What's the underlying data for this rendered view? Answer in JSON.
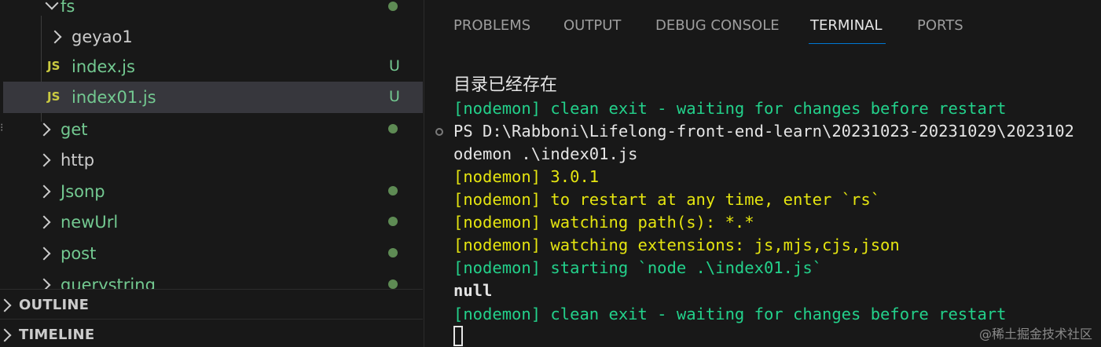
{
  "explorer": {
    "items": [
      {
        "label": "fs",
        "kind": "folder",
        "expanded": true,
        "decoration": "dot"
      },
      {
        "label": "geyao1",
        "kind": "folder",
        "expanded": false
      },
      {
        "label": "index.js",
        "kind": "file",
        "icon": "JS",
        "status": "U"
      },
      {
        "label": "index01.js",
        "kind": "file",
        "icon": "JS",
        "status": "U",
        "selected": true
      },
      {
        "label": "get",
        "kind": "folder",
        "expanded": false,
        "decoration": "dot"
      },
      {
        "label": "http",
        "kind": "folder",
        "expanded": false
      },
      {
        "label": "Jsonp",
        "kind": "folder",
        "expanded": false,
        "decoration": "dot"
      },
      {
        "label": "newUrl",
        "kind": "folder",
        "expanded": false,
        "decoration": "dot"
      },
      {
        "label": "post",
        "kind": "folder",
        "expanded": false,
        "decoration": "dot"
      },
      {
        "label": "querystring",
        "kind": "folder",
        "expanded": false,
        "decoration": "dot"
      }
    ],
    "sections": {
      "outline": "OUTLINE",
      "timeline": "TIMELINE"
    },
    "colors": {
      "modified_green": "#73c991",
      "folder_green": "#5e8b54",
      "js_yellow": "#cbcb41"
    }
  },
  "panel": {
    "tabs": [
      "PROBLEMS",
      "OUTPUT",
      "DEBUG CONSOLE",
      "TERMINAL",
      "PORTS"
    ],
    "active_tab": "TERMINAL",
    "terminal_lines": [
      {
        "parts": [
          {
            "text": "目录已经存在",
            "color": "white"
          }
        ]
      },
      {
        "parts": [
          {
            "text": "[nodemon] clean exit - waiting for changes before restart",
            "color": "green"
          }
        ]
      },
      {
        "parts": [
          {
            "text": "PS D:\\Rabboni\\Lifelong-front-end-learn\\20231023-20231029\\2023102",
            "color": "white"
          }
        ]
      },
      {
        "parts": [
          {
            "text": "odemon .\\index01.js",
            "color": "white"
          }
        ]
      },
      {
        "parts": [
          {
            "text": "[nodemon] 3.0.1",
            "color": "yellow"
          }
        ]
      },
      {
        "parts": [
          {
            "text": "[nodemon] to restart at any time, enter `rs`",
            "color": "yellow"
          }
        ]
      },
      {
        "parts": [
          {
            "text": "[nodemon] watching path(s): *.*",
            "color": "yellow"
          }
        ]
      },
      {
        "parts": [
          {
            "text": "[nodemon] watching extensions: js,mjs,cjs,json",
            "color": "yellow"
          }
        ]
      },
      {
        "parts": [
          {
            "text": "[nodemon] starting `node .\\index01.js`",
            "color": "green"
          }
        ]
      },
      {
        "parts": [
          {
            "text": "null",
            "color": "white"
          }
        ]
      },
      {
        "parts": [
          {
            "text": "[nodemon] clean exit - waiting for changes before restart",
            "color": "green"
          }
        ]
      }
    ],
    "colors": {
      "green": "#23d18b",
      "yellow": "#e5e510",
      "white": "#e5e5e5",
      "accent": "#0078d4"
    }
  },
  "watermark": "@稀土掘金技术社区"
}
